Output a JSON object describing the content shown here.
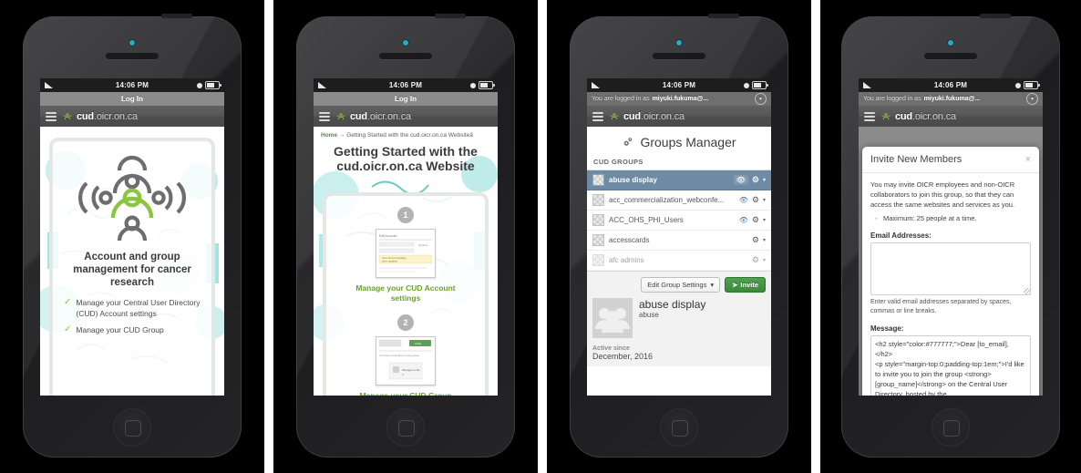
{
  "status_bar": {
    "time": "14:06 PM"
  },
  "brand": {
    "bold": "cud",
    "rest": ".oicr.on.ca"
  },
  "phone1": {
    "login_label": "Log In",
    "headline": "Account and group management for cancer research",
    "bullets": [
      "Manage your Central User Directory (CUD) Account settings",
      "Manage your CUD Group"
    ]
  },
  "phone2": {
    "login_label": "Log In",
    "breadcrumb_home": "Home",
    "breadcrumb_arrow": "→",
    "breadcrumb_rest": "Getting Started with the cud.oicr.on.ca Websiteâ",
    "title": "Getting Started with the cud.oicr.on.ca Website",
    "steps": [
      {
        "num": "1",
        "label": "Manage your CUD Account settings"
      },
      {
        "num": "2",
        "label": "Manage your CUD Group"
      }
    ]
  },
  "phone3": {
    "logged_prefix": "You are logged in as",
    "logged_user": "miyuki.fukuma@...",
    "page_title": "Groups Manager",
    "section_label": "CUD GROUPS",
    "groups": [
      {
        "name": "abuse display",
        "selected": true,
        "eye": true
      },
      {
        "name": "acc_commercialization_webconfe...",
        "selected": false,
        "eye": true
      },
      {
        "name": "ACC_OHS_PHI_Users",
        "selected": false,
        "eye": true
      },
      {
        "name": "accesscards",
        "selected": false,
        "eye": false
      },
      {
        "name": "afc admins",
        "selected": false,
        "eye": false
      }
    ],
    "edit_button": "Edit Group Settings",
    "edit_caret": "▾",
    "invite_button": "Invite",
    "group_title": "abuse display",
    "group_sub": "abuse",
    "active_label": "Active since",
    "active_value": "December, 2016"
  },
  "phone4": {
    "modal_title": "Invite New Members",
    "close_glyph": "×",
    "intro": "You may invite OICR employees and non-OICR collaborators to join this group, so that they can access the same websites and services as you.",
    "bullet": "Maximum: 25 people at a time.",
    "email_label": "Email Addresses:",
    "email_value": "",
    "email_hint": "Enter valid email addresses separated by spaces, commas or line breaks.",
    "message_label": "Message:",
    "message_value": "<h2 style=\"color:#777777;\">Dear [to_email],</h2>\n<p style=\"margin-top:0;padding-top:1em;\">I'd like to invite you to join the group <strong>[group_name]</strong> on the Central User Directory, hosted by the"
  },
  "colors": {
    "brand_green": "#8cc63e",
    "link_green": "#6aa32b",
    "selected_row": "#6f8ba4",
    "invite_green": "#3b8a3b"
  }
}
